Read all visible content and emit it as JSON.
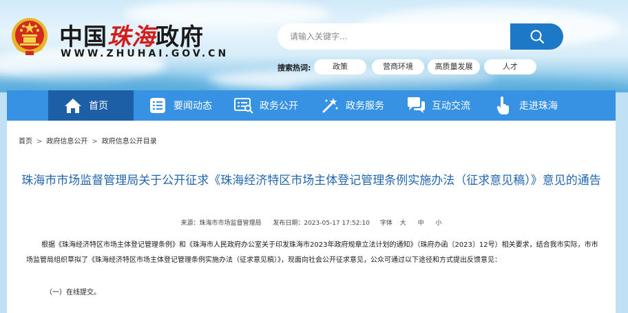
{
  "header": {
    "logo_text_1": "中国",
    "logo_text_2": "珠海",
    "logo_text_3": "政府",
    "logo_url": "WWW.ZHUHAI.GOV.CN",
    "search_placeholder": "请输入关键字...",
    "hot_label": "搜索热词:",
    "hot_tags": [
      "政策",
      "营商环境",
      "高质量发展",
      "人才"
    ]
  },
  "nav": {
    "items": [
      {
        "label": "首页",
        "icon": "home-icon"
      },
      {
        "label": "要闻动态",
        "icon": "news-list-icon"
      },
      {
        "label": "政务公开",
        "icon": "open-gov-icon"
      },
      {
        "label": "政务服务",
        "icon": "service-wand-icon"
      },
      {
        "label": "互动交流",
        "icon": "chat-icon"
      },
      {
        "label": "走进珠海",
        "icon": "hand-pointer-icon"
      }
    ]
  },
  "breadcrumb": [
    "首页",
    "政府信息公开",
    "政府信息公开目录"
  ],
  "article": {
    "title": "珠海市市场监督管理局关于公开征求《珠海经济特区市场主体登记管理条例实施办法（征求意见稿）》意见的通告",
    "source": "来源：珠海市市场监督管理局",
    "date": "发布日期：2023-05-17 17:52:10",
    "font_label": "字体",
    "font_sizes": [
      "大",
      "中",
      "小"
    ],
    "paragraph": "根据《珠海经济特区市场主体登记管理条例》和《珠海市人民政府办公室关于印发珠海市2023年政府规章立法计划的通知》（珠府办函〔2023〕12号）相关要求，结合我市实际，市市场监管局组织草拟了《珠海经济特区市场主体登记管理条例实施办法（征求意见稿）》，现面向社会公开征求意见，公众可通过以下途径和方式提出反馈意见：",
    "subheading": "（一）在线提交。"
  },
  "colors": {
    "nav_bg": "#3892e3",
    "nav_active": "#1d5fa6",
    "title": "#2366b0",
    "brand_red": "#d21d1d"
  }
}
